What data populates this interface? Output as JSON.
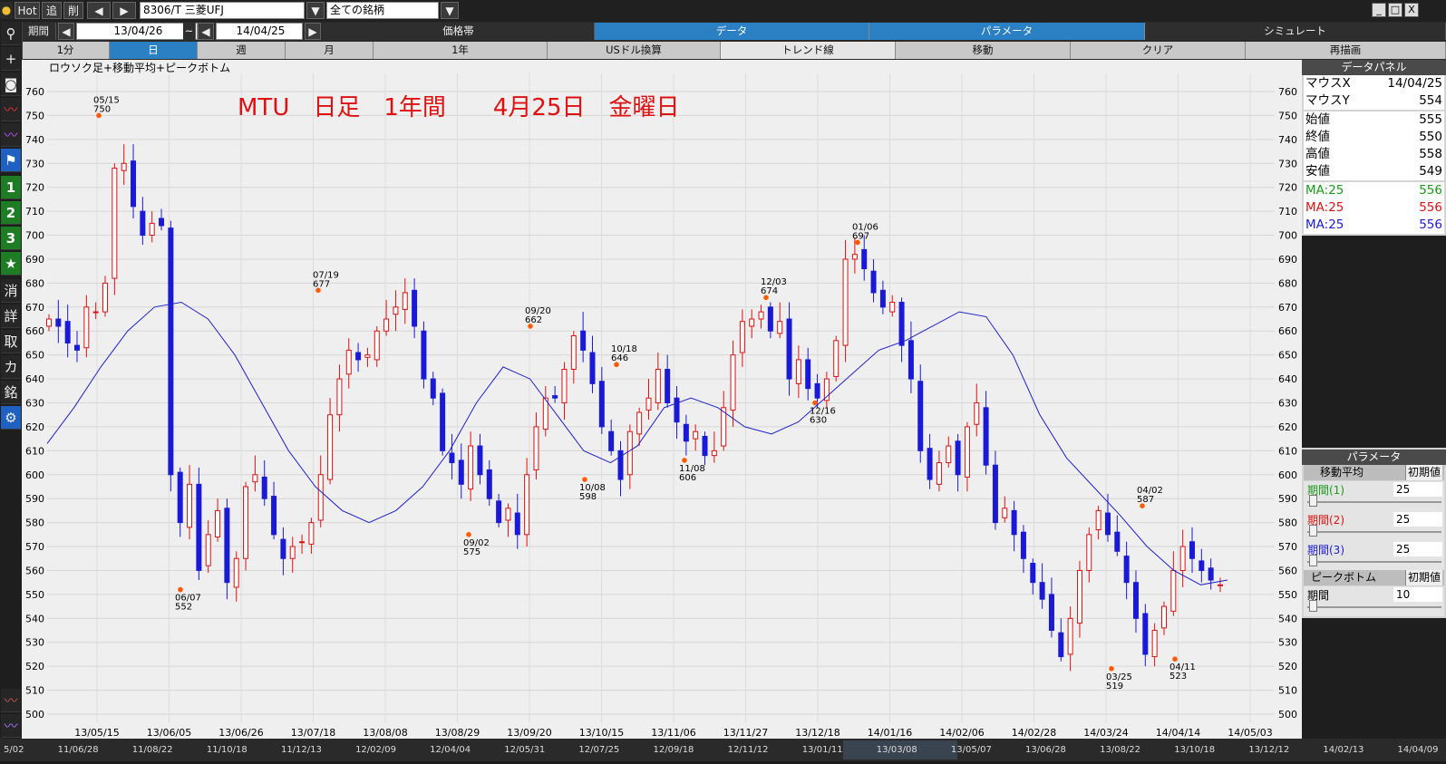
{
  "topbar": {
    "hot": "Hot",
    "add": "追",
    "del": "削",
    "symbol": "8306/T 三菱UFJ",
    "universe": "全ての銘柄",
    "win_min": "_",
    "win_max": "□",
    "win_close": "X"
  },
  "row2": {
    "period_label": "期間",
    "from": "13/04/26",
    "tilde": "~",
    "to": "14/04/25",
    "tabs": [
      "価格帯",
      "データ",
      "パラメータ",
      "シミュレート"
    ]
  },
  "row3": {
    "tabs": [
      "1分",
      "日",
      "週",
      "月",
      "1年",
      "USドル換算",
      "トレンド線",
      "移動",
      "クリア",
      "再描画"
    ]
  },
  "lefttoolbar": [
    "search-icon",
    "crosshair-icon",
    "camera-icon",
    "line-chart-icon",
    "area-chart-icon",
    "flag-icon",
    "1",
    "2",
    "3",
    "★",
    "消",
    "詳",
    "取",
    "カ",
    "銘",
    "gear-icon"
  ],
  "data_panel": {
    "title": "データパネル",
    "rows": [
      {
        "k": "マウスX",
        "v": "14/04/25"
      },
      {
        "k": "マウスY",
        "v": "554"
      },
      {
        "k": "始値",
        "v": "555"
      },
      {
        "k": "終値",
        "v": "550"
      },
      {
        "k": "高値",
        "v": "558"
      },
      {
        "k": "安値",
        "v": "549"
      }
    ],
    "ma_rows": [
      {
        "k": "MA:25",
        "v": "556",
        "color": "#1a9a1a"
      },
      {
        "k": "MA:25",
        "v": "556",
        "color": "#dd1111"
      },
      {
        "k": "MA:25",
        "v": "556",
        "color": "#1a1ad6"
      }
    ]
  },
  "param_panel": {
    "title": "パラメータ",
    "ma_header": "移動平均",
    "init_label": "初期値",
    "ma_sliders": [
      {
        "k": "期間(1)",
        "v": "25",
        "color": "#1a9a1a"
      },
      {
        "k": "期間(2)",
        "v": "25",
        "color": "#dd1111"
      },
      {
        "k": "期間(3)",
        "v": "25",
        "color": "#1a1ad6"
      }
    ],
    "pb_header": "ピークボトム",
    "pb_slider": {
      "k": "期間",
      "v": "10"
    }
  },
  "chart_data": {
    "type": "candlestick",
    "title": "MTU　日足　1年間　　4月25日　金曜日",
    "subtitle": "ロウソク足+移動平均+ピークボトム",
    "ylim": [
      500,
      760
    ],
    "yticks": [
      500,
      510,
      520,
      530,
      540,
      550,
      560,
      570,
      580,
      590,
      600,
      610,
      620,
      630,
      640,
      650,
      660,
      670,
      680,
      690,
      700,
      710,
      720,
      730,
      740,
      750,
      760
    ],
    "date_ticks": [
      "13/05/15",
      "13/06/05",
      "13/06/26",
      "13/07/18",
      "13/08/08",
      "13/08/29",
      "13/09/20",
      "13/10/15",
      "13/11/06",
      "13/11/27",
      "13/12/18",
      "14/01/16",
      "14/02/06",
      "14/02/28",
      "14/03/24",
      "14/04/14",
      "14/05/03"
    ],
    "bottom_ticks": [
      "5/02",
      "11/06/28",
      "11/08/22",
      "11/10/18",
      "11/12/13",
      "12/02/09",
      "12/04/04",
      "12/05/31",
      "12/07/25",
      "12/09/18",
      "12/11/12",
      "13/01/11",
      "13/03/08",
      "13/05/07",
      "13/06/28",
      "13/08/22",
      "13/10/18",
      "13/12/12",
      "14/02/13",
      "14/04/09"
    ],
    "peak_bottoms": [
      {
        "date": "05/15",
        "value": 750,
        "kind": "peak"
      },
      {
        "date": "06/07",
        "value": 552,
        "kind": "bottom"
      },
      {
        "date": "07/19",
        "value": 677,
        "kind": "peak"
      },
      {
        "date": "09/02",
        "value": 575,
        "kind": "bottom"
      },
      {
        "date": "09/20",
        "value": 662,
        "kind": "peak"
      },
      {
        "date": "10/08",
        "value": 598,
        "kind": "bottom"
      },
      {
        "date": "10/18",
        "value": 646,
        "kind": "peak"
      },
      {
        "date": "11/08",
        "value": 606,
        "kind": "bottom"
      },
      {
        "date": "12/03",
        "value": 674,
        "kind": "peak"
      },
      {
        "date": "12/16",
        "value": 630,
        "kind": "bottom"
      },
      {
        "date": "01/06",
        "value": 697,
        "kind": "peak"
      },
      {
        "date": "03/25",
        "value": 519,
        "kind": "bottom"
      },
      {
        "date": "04/02",
        "value": 587,
        "kind": "peak"
      },
      {
        "date": "04/11",
        "value": 523,
        "kind": "bottom"
      }
    ],
    "ma_series": {
      "name": "MA:25",
      "values": [
        613,
        628,
        645,
        660,
        670,
        672,
        665,
        650,
        630,
        610,
        595,
        585,
        580,
        585,
        595,
        610,
        630,
        645,
        640,
        625,
        610,
        605,
        612,
        628,
        632,
        628,
        620,
        617,
        622,
        632,
        642,
        652,
        656,
        662,
        668,
        666,
        650,
        625,
        607,
        595,
        583,
        570,
        560,
        554,
        556
      ]
    },
    "closes": [
      665,
      662,
      655,
      652,
      670,
      668,
      680,
      728,
      730,
      712,
      700,
      705,
      704,
      600,
      580,
      596,
      560,
      575,
      585,
      555,
      565,
      595,
      600,
      590,
      575,
      565,
      570,
      572,
      580,
      600,
      625,
      640,
      652,
      648,
      650,
      660,
      665,
      670,
      676,
      662,
      640,
      632,
      610,
      605,
      596,
      612,
      600,
      590,
      580,
      586,
      575,
      600,
      620,
      632,
      632,
      644,
      658,
      652,
      638,
      620,
      610,
      598,
      618,
      626,
      632,
      644,
      630,
      622,
      614,
      618,
      608,
      610,
      628,
      650,
      664,
      665,
      668,
      660,
      664,
      640,
      648,
      636,
      632,
      640,
      656,
      690,
      692,
      686,
      676,
      670,
      672,
      654,
      640,
      610,
      598,
      605,
      612,
      600,
      620,
      630,
      604,
      580,
      586,
      575,
      565,
      555,
      548,
      535,
      524,
      540,
      560,
      575,
      585,
      575,
      568,
      555,
      540,
      525,
      535,
      545,
      560,
      570,
      565,
      560,
      556,
      554
    ]
  }
}
